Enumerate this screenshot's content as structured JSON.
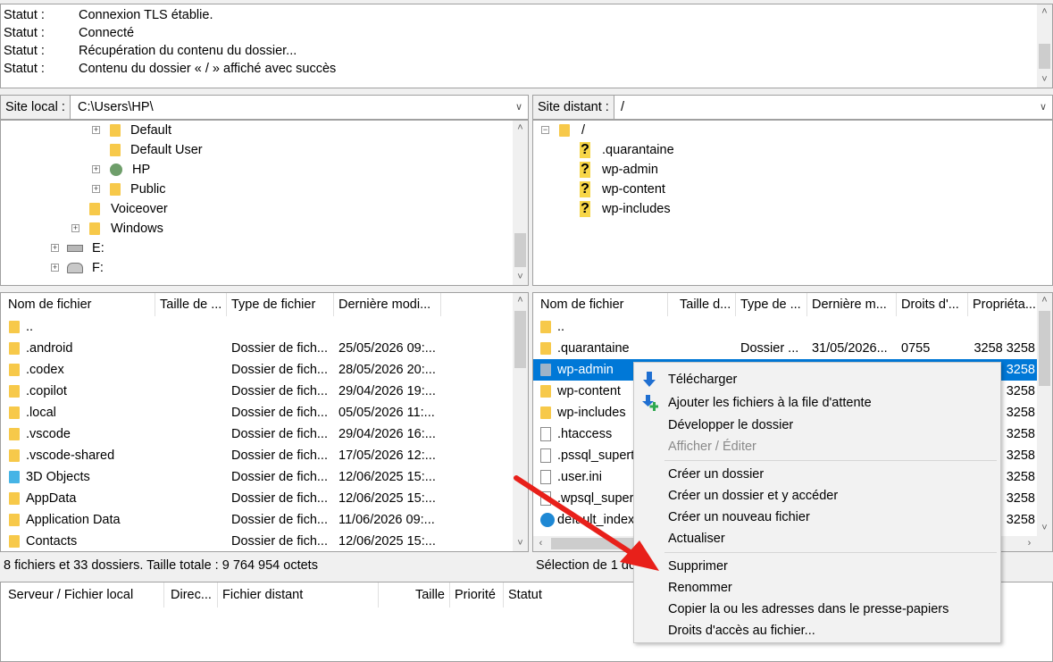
{
  "log": {
    "rows": [
      {
        "key": "Statut :",
        "msg": "Connexion TLS établie."
      },
      {
        "key": "Statut :",
        "msg": "Connecté"
      },
      {
        "key": "Statut :",
        "msg": "Récupération du contenu du dossier..."
      },
      {
        "key": "Statut :",
        "msg": "Contenu du dossier « / » affiché avec succès"
      }
    ]
  },
  "local": {
    "site_label": "Site local :",
    "path": "C:\\Users\\HP\\",
    "tree": [
      "Default",
      "Default User",
      "HP",
      "Public",
      "Voiceover",
      "Windows",
      "E:",
      "F:"
    ],
    "headers": [
      "Nom de fichier",
      "Taille de ...",
      "Type de fichier",
      "Dernière modi..."
    ],
    "files": [
      {
        "name": "..",
        "type": "",
        "date": ""
      },
      {
        "name": ".android",
        "type": "Dossier de fich...",
        "date": "25/05/2026 09:..."
      },
      {
        "name": ".codex",
        "type": "Dossier de fich...",
        "date": "28/05/2026 20:..."
      },
      {
        "name": ".copilot",
        "type": "Dossier de fich...",
        "date": "29/04/2026 19:..."
      },
      {
        "name": ".local",
        "type": "Dossier de fich...",
        "date": "05/05/2026 11:..."
      },
      {
        "name": ".vscode",
        "type": "Dossier de fich...",
        "date": "29/04/2026 16:..."
      },
      {
        "name": ".vscode-shared",
        "type": "Dossier de fich...",
        "date": "17/05/2026 12:..."
      },
      {
        "name": "3D Objects",
        "type": "Dossier de fich...",
        "date": "12/06/2025 15:..."
      },
      {
        "name": "AppData",
        "type": "Dossier de fich...",
        "date": "12/06/2025 15:..."
      },
      {
        "name": "Application Data",
        "type": "Dossier de fich...",
        "date": "11/06/2026 09:..."
      },
      {
        "name": "Contacts",
        "type": "Dossier de fich...",
        "date": "12/06/2025 15:..."
      }
    ],
    "status": "8 fichiers et 33 dossiers. Taille totale : 9 764 954 octets"
  },
  "remote": {
    "site_label": "Site distant :",
    "path": "/",
    "tree_root": "/",
    "tree": [
      ".quarantaine",
      "wp-admin",
      "wp-content",
      "wp-includes"
    ],
    "headers": [
      "Nom de fichier",
      "Taille d...",
      "Type de ...",
      "Dernière m...",
      "Droits d'...",
      "Propriéta..."
    ],
    "files": [
      {
        "name": "..",
        "type": "",
        "date": "",
        "perm": "",
        "owner": ""
      },
      {
        "name": ".quarantaine",
        "type": "Dossier ...",
        "date": "31/05/2026...",
        "perm": "0755",
        "owner": "3258 3258"
      },
      {
        "name": "wp-admin",
        "type": "",
        "date": "",
        "perm": "",
        "owner": "3258"
      },
      {
        "name": "wp-content",
        "type": "",
        "date": "",
        "perm": "",
        "owner": "3258"
      },
      {
        "name": "wp-includes",
        "type": "",
        "date": "",
        "perm": "",
        "owner": "3258"
      },
      {
        "name": ".htaccess",
        "type": "",
        "date": "",
        "perm": "",
        "owner": "3258"
      },
      {
        "name": ".pssql_superto",
        "type": "",
        "date": "",
        "perm": "",
        "owner": "3258"
      },
      {
        "name": ".user.ini",
        "type": "",
        "date": "",
        "perm": "",
        "owner": "3258"
      },
      {
        "name": ".wpsql_supert",
        "type": "",
        "date": "",
        "perm": "",
        "owner": "3258"
      },
      {
        "name": "default_index",
        "type": "",
        "date": "",
        "perm": "",
        "owner": "3258"
      }
    ],
    "status": "Sélection de 1 do"
  },
  "queue": {
    "headers": [
      "Serveur / Fichier local",
      "Direc...",
      "Fichier distant",
      "Taille",
      "Priorité",
      "Statut"
    ]
  },
  "context_menu": {
    "items": [
      {
        "label": "Télécharger",
        "icon": "download-arrow-icon"
      },
      {
        "label": "Ajouter les fichiers à la file d'attente",
        "icon": "add-to-queue-icon"
      },
      {
        "label": "Développer le dossier"
      },
      {
        "label": "Afficher / Éditer",
        "disabled": true
      },
      {
        "label": "Créer un dossier"
      },
      {
        "label": "Créer un dossier et y accéder"
      },
      {
        "label": "Créer un nouveau fichier"
      },
      {
        "label": "Actualiser"
      },
      {
        "label": "Supprimer"
      },
      {
        "label": "Renommer"
      },
      {
        "label": "Copier la ou les adresses dans le presse-papiers"
      },
      {
        "label": "Droits d'accès au fichier..."
      }
    ]
  },
  "colors": {
    "selection": "#0078d7",
    "arrow": "#e8201a",
    "folder": "#f7c94a"
  }
}
